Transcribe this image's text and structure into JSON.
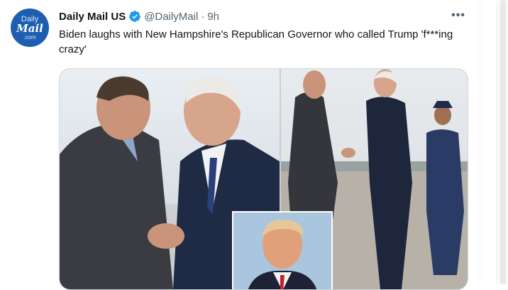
{
  "tweet": {
    "avatar": {
      "line1": "Daily",
      "line2": "Mail",
      "line3": ".com"
    },
    "display_name": "Daily Mail US",
    "handle": "@DailyMail",
    "separator": "·",
    "time": "9h",
    "more_label": "•••",
    "text": "Biden laughs with New Hampshire's Republican Governor who called Trump 'f***ing crazy'"
  },
  "colors": {
    "verified_blue": "#1d9bf0",
    "avatar_bg": "#1d5eb0",
    "secondary_text": "#536471",
    "primary_text": "#0f1419"
  },
  "icons": {
    "verified": "verified-badge-icon",
    "more": "more-dots-icon"
  }
}
